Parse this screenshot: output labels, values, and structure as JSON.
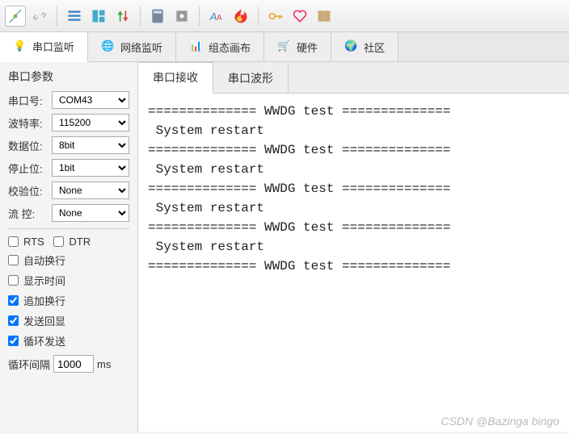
{
  "toolbar": {
    "icons": [
      "plug-icon",
      "link-break-icon",
      "list-icon",
      "layout-icon",
      "sort-icon",
      "calc-icon",
      "config-icon",
      "font-icon",
      "flame-icon",
      "key-icon",
      "heart-icon",
      "book-icon"
    ]
  },
  "mainTabs": [
    {
      "label": "串口监听",
      "icon": "bulb-icon",
      "active": true
    },
    {
      "label": "网络监听",
      "icon": "globe-icon",
      "active": false
    },
    {
      "label": "组态画布",
      "icon": "chart-icon",
      "active": false
    },
    {
      "label": "硬件",
      "icon": "cart-icon",
      "active": false
    },
    {
      "label": "社区",
      "icon": "community-icon",
      "active": false
    }
  ],
  "sidebar": {
    "title": "串口参数",
    "fields": {
      "port": {
        "label": "串口号:",
        "value": "COM43"
      },
      "baud": {
        "label": "波特率:",
        "value": "115200"
      },
      "data": {
        "label": "数据位:",
        "value": "8bit"
      },
      "stop": {
        "label": "停止位:",
        "value": "1bit"
      },
      "parity": {
        "label": "校验位:",
        "value": "None"
      },
      "flow": {
        "label": "流  控:",
        "value": "None"
      }
    },
    "checks": {
      "rts": {
        "label": "RTS",
        "checked": false
      },
      "dtr": {
        "label": "DTR",
        "checked": false
      },
      "autowrap": {
        "label": "自动换行",
        "checked": false
      },
      "showtime": {
        "label": "显示时间",
        "checked": false
      },
      "appendnl": {
        "label": "追加换行",
        "checked": true
      },
      "echo": {
        "label": "发送回显",
        "checked": true
      },
      "loop": {
        "label": "循环发送",
        "checked": true
      }
    },
    "interval": {
      "label": "循环间隔",
      "value": "1000",
      "unit": "ms"
    }
  },
  "innerTabs": [
    {
      "label": "串口接收",
      "active": true
    },
    {
      "label": "串口波形",
      "active": false
    }
  ],
  "terminal": "============== WWDG test ==============\n System restart\n============== WWDG test ==============\n System restart\n============== WWDG test ==============\n System restart\n============== WWDG test ==============\n System restart\n============== WWDG test ==============",
  "watermark": "CSDN @Bazinga bingo"
}
